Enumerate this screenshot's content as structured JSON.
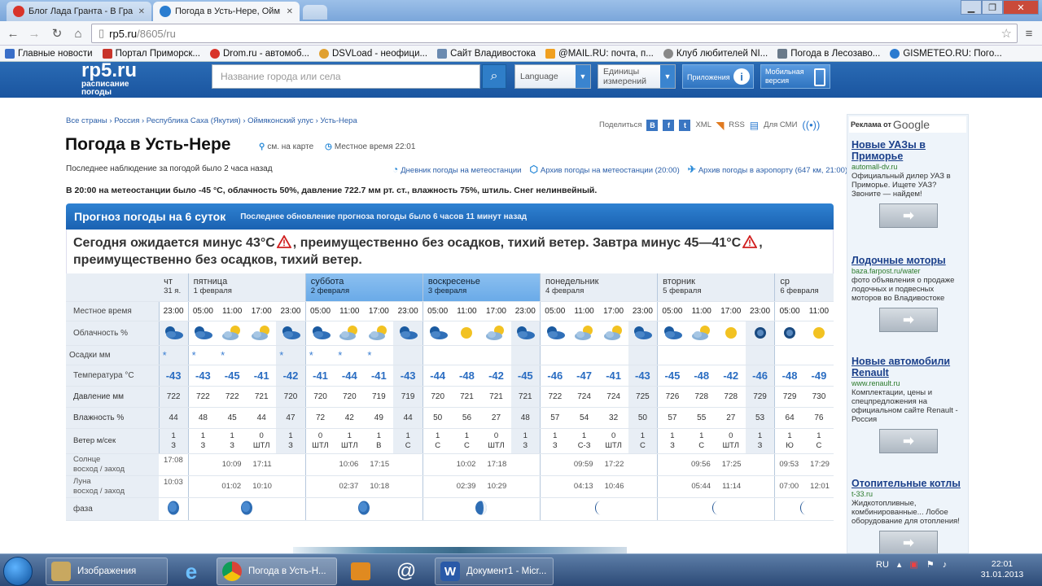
{
  "browser": {
    "tabs": [
      {
        "title": "Блог Лада Гранта - В Гра",
        "active": false
      },
      {
        "title": "Погода в Усть-Нере, Ойм",
        "active": true
      }
    ],
    "url_host": "rp5.ru",
    "url_path": "/8605/ru",
    "bookmarks": [
      "Главные новости",
      "Портал Приморск...",
      "Drom.ru - автомоб...",
      "DSVLoad - неофици...",
      "Сайт Владивостока",
      "@MAIL.RU: почта, п...",
      "Клуб любителей NI...",
      "Погода в Лесозаво...",
      "GISMETEO.RU: Пого..."
    ]
  },
  "header": {
    "logo_text": "rp5.ru",
    "logo_sub1": "расписание",
    "logo_sub2": "погоды",
    "search_placeholder": "Название города или села",
    "language_label": "Language",
    "units_label": "Единицы измерений",
    "apps_label": "Приложения",
    "mobile_label": "Мобильная версия"
  },
  "breadcrumb": "Все страны › Россия › Республика Саха (Якутия) › Оймяконский улус › Усть-Нера",
  "share": {
    "label": "Поделиться",
    "xml": "XML",
    "rss": "RSS",
    "smi": "Для СМИ"
  },
  "title": "Погода в Усть-Нере",
  "title_meta": {
    "map": "см. на карте",
    "local_time": "Местное время  22:01"
  },
  "last_observation": "Последнее наблюдение за погодой было 2 часа назад",
  "archives": [
    "Дневник погоды на метеостанции",
    "Архив погоды на метеостанции (20:00)",
    "Архив погоды в аэропорту (647 км, 21:00)"
  ],
  "observation_line": "В 20:00 на метеостанции было -45 °C, облачность 50%, давление 722.7 мм рт. ст., влажность 75%, штиль. Снег нелинвейный.",
  "forecast": {
    "heading": "Прогноз погоды на 6 суток",
    "updated": "Последнее обновление прогноза погоды было 6 часов 11 минут назад",
    "summary_part1": "Сегодня ожидается минус 43°C",
    "summary_part2": ", преимущественно без осадков, тихий ветер. Завтра минус 45—41°C",
    "summary_part3": ", преимущественно без осадков, тихий ветер.",
    "row_labels": {
      "time": "Местное время",
      "cloud": "Облачность %",
      "precip": "Осадки мм",
      "temp": "Температура °C",
      "pressure": "Давление мм",
      "humidity": "Влажность %",
      "wind": "Ветер м/сек",
      "sun": "Солнце",
      "moon": "Луна",
      "rise_set": "восход / заход",
      "phase": "фаза"
    },
    "days": [
      {
        "name": "чт",
        "date": "31 я.",
        "cols": 1,
        "weekend": false
      },
      {
        "name": "пятница",
        "date": "1 февраля",
        "cols": 4,
        "weekend": false
      },
      {
        "name": "суббота",
        "date": "2 февраля",
        "cols": 4,
        "weekend": true
      },
      {
        "name": "воскресенье",
        "date": "3 февраля",
        "cols": 4,
        "weekend": true
      },
      {
        "name": "понедельник",
        "date": "4 февраля",
        "cols": 4,
        "weekend": false
      },
      {
        "name": "вторник",
        "date": "5 февраля",
        "cols": 4,
        "weekend": false
      },
      {
        "name": "ср",
        "date": "6 февраля",
        "cols": 2,
        "weekend": false
      }
    ],
    "times": [
      "23:00",
      "05:00",
      "11:00",
      "17:00",
      "23:00",
      "05:00",
      "11:00",
      "17:00",
      "23:00",
      "05:00",
      "11:00",
      "17:00",
      "23:00",
      "05:00",
      "11:00",
      "17:00",
      "23:00",
      "05:00",
      "11:00",
      "17:00",
      "23:00",
      "05:00",
      "11:00"
    ],
    "clouds": [
      "night-cloud",
      "night-cloud",
      "partly",
      "partly",
      "night-cloud",
      "night-cloud",
      "partly",
      "partly",
      "night-cloud",
      "night-cloud",
      "sun",
      "partly",
      "night-cloud",
      "night-cloud",
      "partly",
      "partly",
      "night-cloud",
      "night-cloud",
      "partly",
      "sun",
      "moon",
      "moon",
      "sun"
    ],
    "precip": [
      "*",
      "*",
      "*",
      "",
      "*",
      "*",
      "*",
      "*",
      "",
      "",
      "",
      "",
      "",
      "",
      "",
      "",
      "",
      "",
      "",
      "",
      "",
      "",
      ""
    ],
    "temps": [
      "-43",
      "-43",
      "-45",
      "-41",
      "-42",
      "-41",
      "-44",
      "-41",
      "-43",
      "-44",
      "-48",
      "-42",
      "-45",
      "-46",
      "-47",
      "-41",
      "-43",
      "-45",
      "-48",
      "-42",
      "-46",
      "-48",
      "-49"
    ],
    "pressure": [
      "722",
      "722",
      "722",
      "721",
      "720",
      "720",
      "720",
      "719",
      "719",
      "720",
      "721",
      "721",
      "721",
      "722",
      "724",
      "724",
      "725",
      "726",
      "728",
      "728",
      "729",
      "729",
      "730"
    ],
    "humidity": [
      "44",
      "48",
      "45",
      "44",
      "47",
      "72",
      "42",
      "49",
      "44",
      "50",
      "56",
      "27",
      "48",
      "57",
      "54",
      "32",
      "50",
      "57",
      "55",
      "27",
      "53",
      "64",
      "76"
    ],
    "wind_speed": [
      "1",
      "1",
      "1",
      "0",
      "1",
      "0",
      "1",
      "1",
      "1",
      "1",
      "1",
      "0",
      "1",
      "1",
      "1",
      "0",
      "1",
      "1",
      "1",
      "0",
      "1",
      "1",
      "1"
    ],
    "wind_dir": [
      "З",
      "З",
      "З",
      "ШТЛ",
      "З",
      "ШТЛ",
      "ШТЛ",
      "В",
      "С",
      "С",
      "С",
      "ШТЛ",
      "З",
      "З",
      "С-З",
      "ШТЛ",
      "С",
      "З",
      "С",
      "ШТЛ",
      "З",
      "Ю",
      "С"
    ],
    "sun": [
      {
        "rise": "17:08",
        "set": ""
      },
      {
        "rise": "10:09",
        "set": "17:11"
      },
      {
        "rise": "10:06",
        "set": "17:15"
      },
      {
        "rise": "10:02",
        "set": "17:18"
      },
      {
        "rise": "09:59",
        "set": "17:22"
      },
      {
        "rise": "09:56",
        "set": "17:25"
      },
      {
        "rise": "09:53",
        "set": "17:29"
      }
    ],
    "moon": [
      {
        "rise": "10:03",
        "set": ""
      },
      {
        "rise": "01:02",
        "set": "10:10"
      },
      {
        "rise": "02:37",
        "set": "10:18"
      },
      {
        "rise": "02:39",
        "set": "10:29"
      },
      {
        "rise": "04:13",
        "set": "10:46"
      },
      {
        "rise": "05:44",
        "set": "11:14"
      },
      {
        "rise": "07:00",
        "set": "12:01"
      }
    ],
    "phases": [
      "full",
      "full",
      "full",
      "waning-gibbous",
      "waning-crescent",
      "waning-crescent",
      "waning-crescent"
    ]
  },
  "ads": {
    "header": "Реклама от",
    "header_brand": "Google",
    "items": [
      {
        "title": "Новые УАЗы в Приморье",
        "url": "automall-dv.ru",
        "desc": "Официальный дилер УАЗ в Приморье. Ищете УАЗ? Звоните — найдем!"
      },
      {
        "title": "Лодочные моторы",
        "url": "baza.farpost.ru/water",
        "desc": "фото объявления о продаже лодочных и подвесных моторов во Владивостоке"
      },
      {
        "title": "Новые автомобили Renault",
        "url": "www.renault.ru",
        "desc": "Комплектации, цены и спецпредложения на официальном сайте Renault - Россия"
      },
      {
        "title": "Отопительные котлы",
        "url": "t-33.ru",
        "desc": "Жидкотопливные, комбинированные... Лобое оборудование для отопления!"
      }
    ]
  },
  "taskbar": {
    "items": [
      "Изображения",
      "Погода в Усть-Н...",
      "Документ1 - Micr..."
    ],
    "lang": "RU",
    "time": "22:01",
    "date": "31.01.2013"
  }
}
